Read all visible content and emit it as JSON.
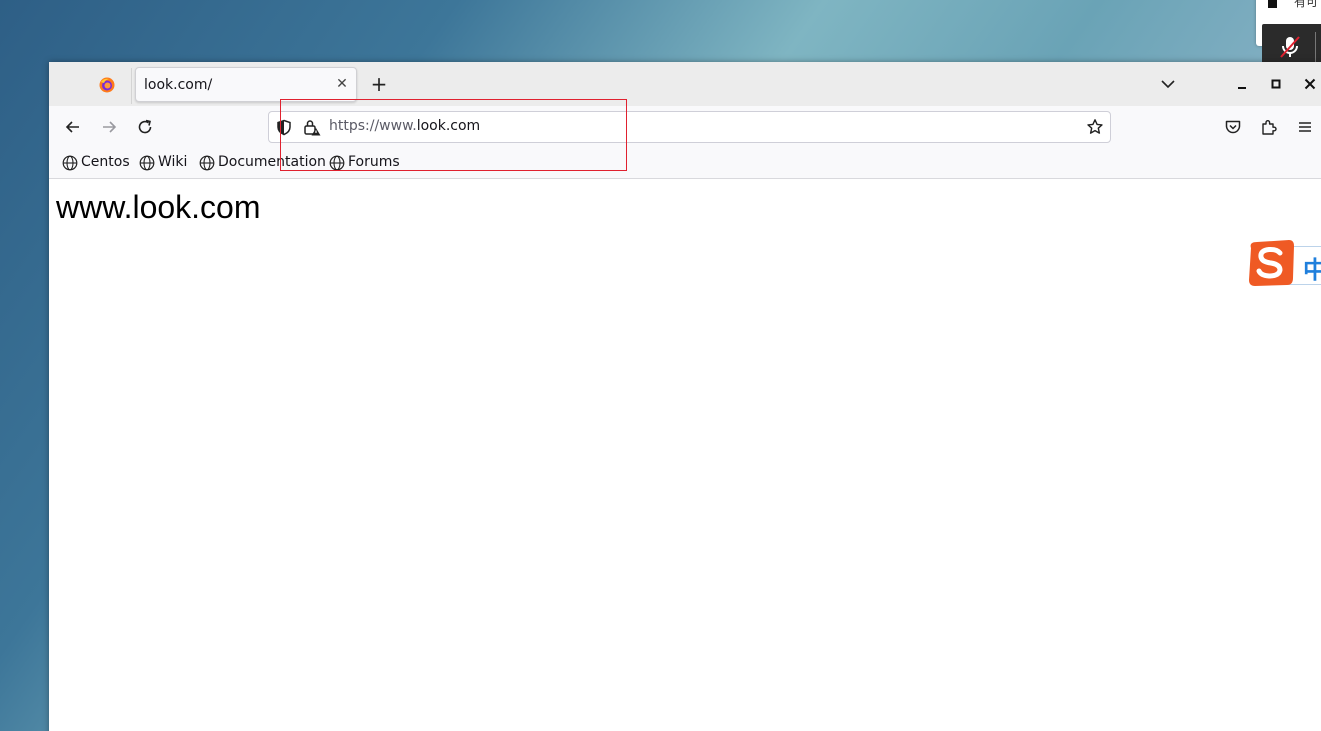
{
  "desktop": {
    "notification_text": "有可"
  },
  "browser": {
    "tab": {
      "title": "look.com/",
      "close_glyph": "✕"
    },
    "new_tab_glyph": "+",
    "address": {
      "scheme_prefix": "https://www.",
      "host": "look.com"
    },
    "bookmarks": [
      {
        "label": "Centos"
      },
      {
        "label": "Wiki"
      },
      {
        "label": "Documentation"
      },
      {
        "label": "Forums"
      }
    ],
    "icons": {
      "logo": "firefox-logo-icon",
      "back": "back-arrow-icon",
      "forward": "forward-arrow-icon",
      "reload": "reload-icon",
      "tracking": "shield-icon",
      "security": "lock-warning-icon",
      "bookmark_star": "star-icon",
      "pocket": "pocket-icon",
      "extensions": "puzzle-icon",
      "menu": "hamburger-menu-icon"
    }
  },
  "page": {
    "heading": "www.look.com"
  },
  "ime": {
    "label": "中"
  },
  "colors": {
    "highlight": "#e0212f",
    "ime_orange": "#ef5a24",
    "ime_blue": "#1f7fdc"
  }
}
